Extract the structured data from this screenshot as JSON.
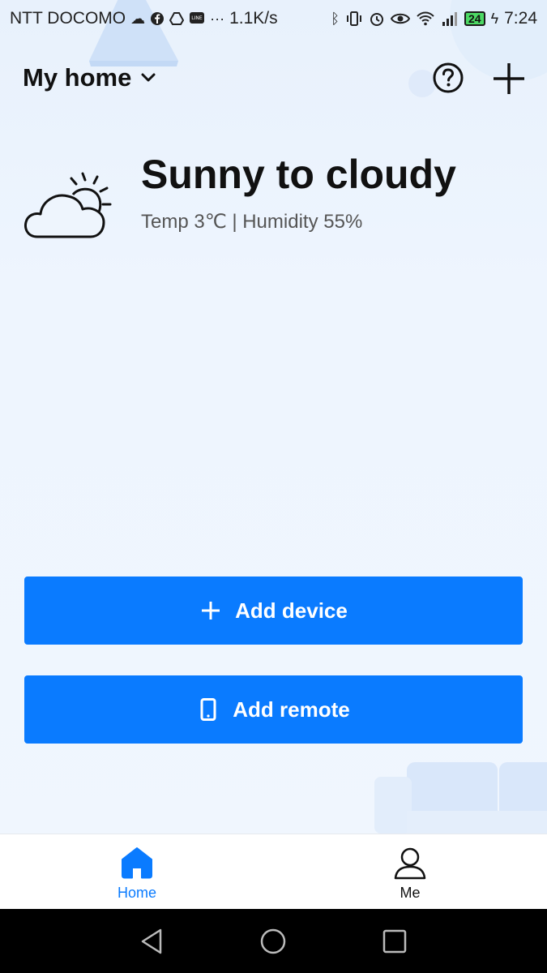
{
  "status_bar": {
    "carrier": "NTT DOCOMO",
    "speed": "1.1K/s",
    "battery": "24",
    "time": "7:24",
    "icons": [
      "cloud-icon",
      "facebook-icon",
      "drive-icon",
      "line-icon",
      "more-icon",
      "bluetooth-icon",
      "vibrate-icon",
      "alarm-icon",
      "eye-icon",
      "wifi-icon",
      "signal-icon",
      "battery-icon",
      "charging-icon"
    ]
  },
  "header": {
    "home_name": "My home",
    "icons": [
      "chevron-down-icon",
      "help-icon",
      "plus-icon"
    ]
  },
  "weather": {
    "condition": "Sunny to cloudy",
    "details": "Temp 3℃ | Humidity 55%",
    "icon": "partly-cloudy-icon"
  },
  "actions": {
    "add_device": "Add device",
    "add_remote": "Add remote"
  },
  "tabs": {
    "home": "Home",
    "me": "Me",
    "active": "home",
    "active_color": "#0a7bff"
  },
  "theme": {
    "accent": "#0a7bff",
    "background": "#eef5fd"
  }
}
